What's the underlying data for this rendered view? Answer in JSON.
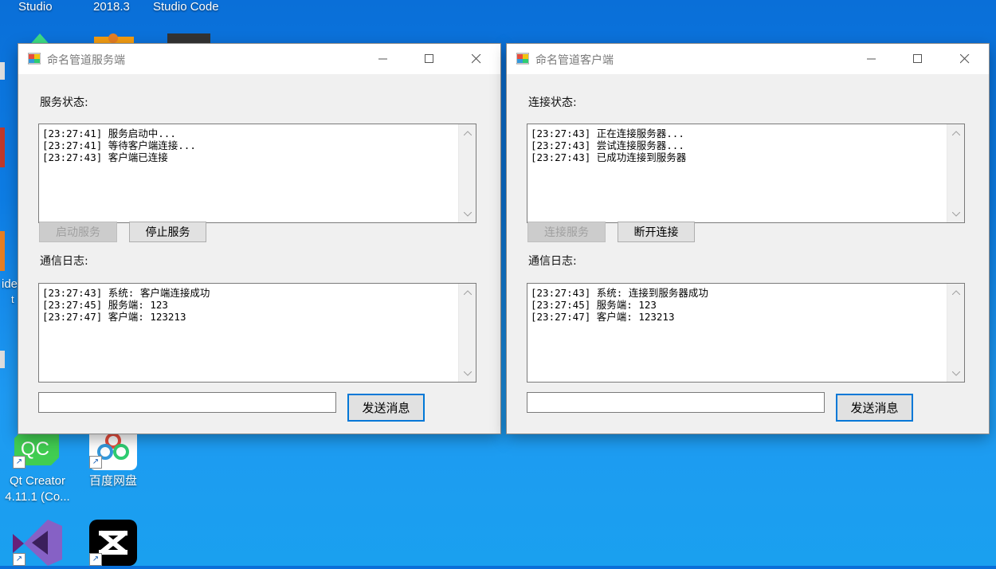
{
  "desktop": {
    "top_labels": [
      "Studio",
      "2018.3",
      "Studio Code"
    ],
    "icons": [
      {
        "label_line1": "Qt Creator",
        "label_line2": "4.11.1 (Co...",
        "icon": "qt-creator-icon"
      },
      {
        "label_line1": "百度网盘",
        "label_line2": "",
        "icon": "baidu-netdisk-icon"
      }
    ],
    "edge_fragments": [
      "ide",
      "t"
    ]
  },
  "server_window": {
    "title": "命名管道服务端",
    "status_label": "服务状态:",
    "status_lines": "[23:27:41] 服务启动中...\n[23:27:41] 等待客户端连接...\n[23:27:43] 客户端已连接",
    "start_button": "启动服务",
    "stop_button": "停止服务",
    "log_label": "通信日志:",
    "log_lines": "[23:27:43] 系统: 客户端连接成功\n[23:27:45] 服务端: 123\n[23:27:47] 客户端: 123213",
    "message_value": "",
    "send_button": "发送消息"
  },
  "client_window": {
    "title": "命名管道客户端",
    "status_label": "连接状态:",
    "status_lines": "[23:27:43] 正在连接服务器...\n[23:27:43] 尝试连接服务器...\n[23:27:43] 已成功连接到服务器",
    "connect_button": "连接服务",
    "disconnect_button": "断开连接",
    "log_label": "通信日志:",
    "log_lines": "[23:27:43] 系统: 连接到服务器成功\n[23:27:45] 服务端: 123\n[23:27:47] 客户端: 123213",
    "message_value": "",
    "send_button": "发送消息"
  },
  "colors": {
    "desktop": "#0d7ce3",
    "accent": "#0078d7",
    "window_bg": "#f0f0f0"
  }
}
